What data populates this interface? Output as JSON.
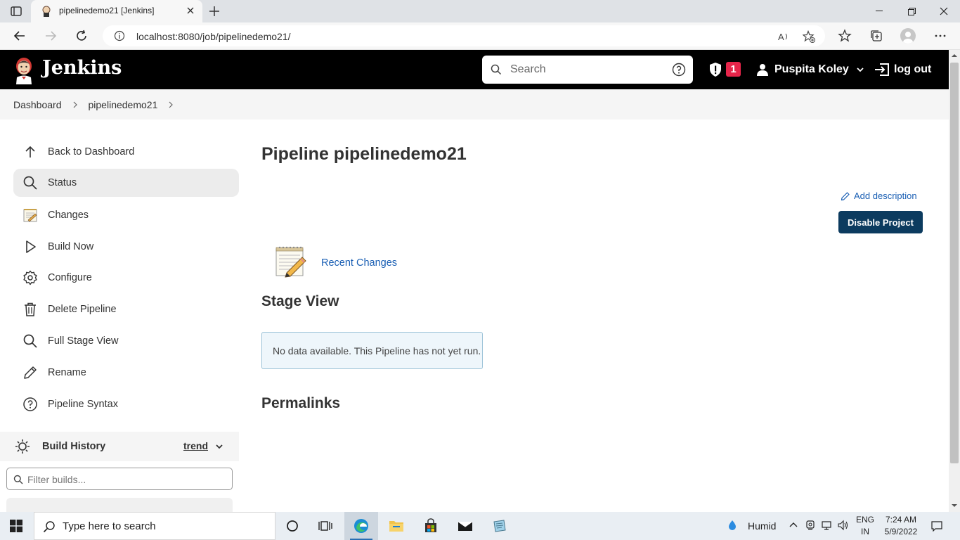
{
  "browser": {
    "tab_title": "pipelinedemo21 [Jenkins]",
    "url": "localhost:8080/job/pipelinedemo21/"
  },
  "header": {
    "brand": "Jenkins",
    "search_placeholder": "Search",
    "security_count": "1",
    "user_name": "Puspita Koley",
    "logout_label": "log out"
  },
  "breadcrumb": {
    "items": [
      "Dashboard",
      "pipelinedemo21"
    ]
  },
  "sidebar": {
    "items": [
      {
        "label": "Back to Dashboard",
        "icon": "arrow-up-icon"
      },
      {
        "label": "Status",
        "icon": "search-icon"
      },
      {
        "label": "Changes",
        "icon": "notepad-icon"
      },
      {
        "label": "Build Now",
        "icon": "play-icon"
      },
      {
        "label": "Configure",
        "icon": "gear-icon"
      },
      {
        "label": "Delete Pipeline",
        "icon": "trash-icon"
      },
      {
        "label": "Full Stage View",
        "icon": "search-icon"
      },
      {
        "label": "Rename",
        "icon": "pencil-icon"
      },
      {
        "label": "Pipeline Syntax",
        "icon": "help-icon"
      }
    ],
    "build_history": {
      "title": "Build History",
      "trend_label": "trend",
      "filter_placeholder": "Filter builds..."
    }
  },
  "main": {
    "title": "Pipeline pipelinedemo21",
    "add_description": "Add description",
    "disable_button": "Disable Project",
    "recent_changes": "Recent Changes",
    "stage_view_heading": "Stage View",
    "no_data_message": "No data available. This Pipeline has not yet run.",
    "permalinks_heading": "Permalinks"
  },
  "taskbar": {
    "search_placeholder": "Type here to search",
    "weather": "Humid",
    "lang_line1": "ENG",
    "lang_line2": "IN",
    "time": "7:24 AM",
    "date": "5/9/2022"
  },
  "colors": {
    "header_bg": "#000000",
    "link": "#1a5fb4",
    "primary_button": "#0c3b5f",
    "badge": "#e6254a",
    "info_box_bg": "#eef6fb"
  }
}
